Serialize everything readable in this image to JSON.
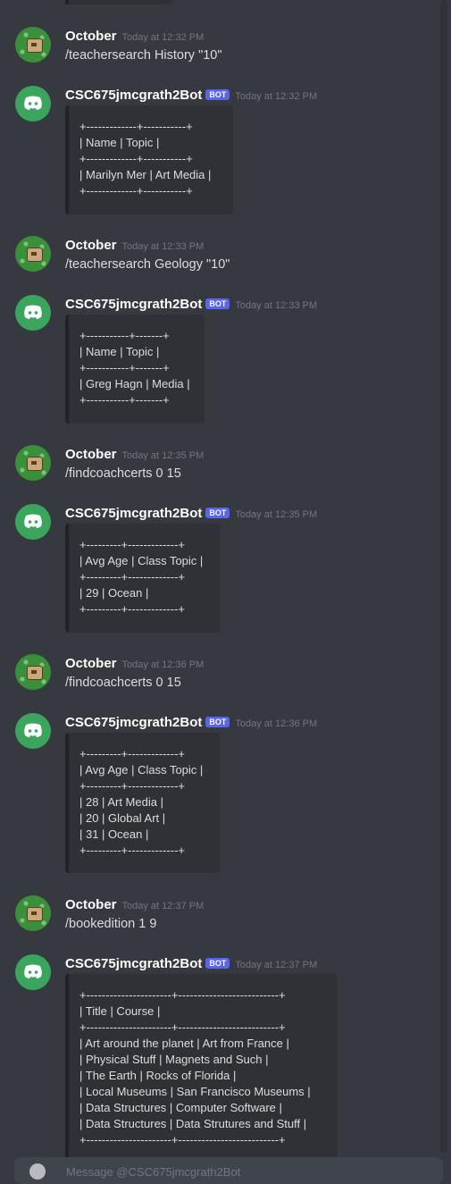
{
  "messages": [
    {
      "author": "October",
      "time": "Today at 12:32 PM",
      "text": "/teachersearch History \"10\""
    },
    {
      "author": "CSC675jmcgrath2Bot",
      "badge": "BOT",
      "time": "Today at 12:32 PM",
      "lines": [
        "+-------------+-----------+",
        "| Name | Topic |",
        "+-------------+-----------+",
        "| Marilyn Mer | Art Media |",
        "+-------------+-----------+"
      ]
    },
    {
      "author": "October",
      "time": "Today at 12:33 PM",
      "text": "/teachersearch Geology \"10\""
    },
    {
      "author": "CSC675jmcgrath2Bot",
      "badge": "BOT",
      "time": "Today at 12:33 PM",
      "lines": [
        "+-----------+-------+",
        "| Name | Topic |",
        "+-----------+-------+",
        "| Greg Hagn | Media |",
        "+-----------+-------+"
      ]
    },
    {
      "author": "October",
      "time": "Today at 12:35 PM",
      "text": "/findcoachcerts 0 15"
    },
    {
      "author": "CSC675jmcgrath2Bot",
      "badge": "BOT",
      "time": "Today at 12:35 PM",
      "lines": [
        "+---------+-------------+",
        "| Avg Age | Class Topic |",
        "+---------+-------------+",
        "| 29 | Ocean |",
        "+---------+-------------+"
      ]
    },
    {
      "author": "October",
      "time": "Today at 12:36 PM",
      "text": "/findcoachcerts 0 15"
    },
    {
      "author": "CSC675jmcgrath2Bot",
      "badge": "BOT",
      "time": "Today at 12:36 PM",
      "lines": [
        "+---------+-------------+",
        "| Avg Age | Class Topic |",
        "+---------+-------------+",
        "| 28 | Art Media |",
        "| 20 | Global Art |",
        "| 31 | Ocean |",
        "+---------+-------------+"
      ]
    },
    {
      "author": "October",
      "time": "Today at 12:37 PM",
      "text": "/bookedition 1 9"
    },
    {
      "author": "CSC675jmcgrath2Bot",
      "badge": "BOT",
      "time": "Today at 12:37 PM",
      "lines": [
        "+----------------------+--------------------------+",
        "| Title | Course |",
        "+----------------------+--------------------------+",
        "| Art around the planet | Art from France |",
        "| Physical Stuff | Magnets and Such |",
        "| The Earth | Rocks of Florida |",
        "| Local Museums | San Francisco Museums |",
        "| Data Structures | Computer Software |",
        "| Data Structures | Data Strutures and Stuff |",
        "+----------------------+--------------------------+"
      ]
    }
  ],
  "composer": {
    "placeholder": "Message @CSC675jmcgrath2Bot"
  },
  "colors": {
    "background": "#36393f",
    "embed": "#2f3136",
    "bot_badge": "#5865f2",
    "bot_avatar": "#3ba55d"
  }
}
